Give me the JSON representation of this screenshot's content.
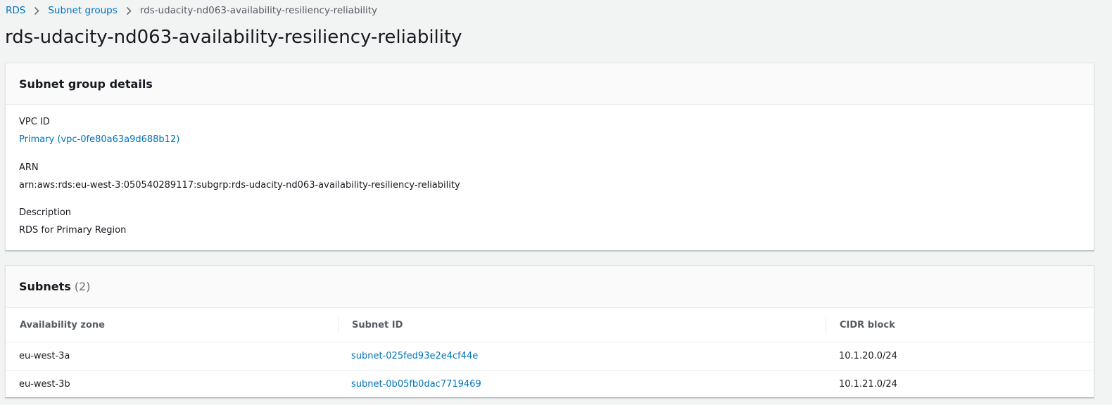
{
  "breadcrumb": {
    "items": [
      "RDS",
      "Subnet groups",
      "rds-udacity-nd063-availability-resiliency-reliability"
    ]
  },
  "page": {
    "title": "rds-udacity-nd063-availability-resiliency-reliability"
  },
  "details": {
    "header": "Subnet group details",
    "vpc_label": "VPC ID",
    "vpc_value": "Primary (vpc-0fe80a63a9d688b12)",
    "arn_label": "ARN",
    "arn_value": "arn:aws:rds:eu-west-3:050540289117:subgrp:rds-udacity-nd063-availability-resiliency-reliability",
    "description_label": "Description",
    "description_value": "RDS for Primary Region"
  },
  "subnets": {
    "header": "Subnets",
    "count": "(2)",
    "columns": [
      "Availability zone",
      "Subnet ID",
      "CIDR block"
    ],
    "rows": [
      [
        "eu-west-3a",
        "subnet-025fed93e2e4cf44e",
        "10.1.20.0/24"
      ],
      [
        "eu-west-3b",
        "subnet-0b05fb0dac7719469",
        "10.1.21.0/24"
      ]
    ]
  },
  "icons": {
    "breadcrumb_separator": "chevron-right-icon"
  },
  "colors": {
    "link": "#0073bb",
    "background": "#f2f3f3",
    "text": "#16191f"
  }
}
